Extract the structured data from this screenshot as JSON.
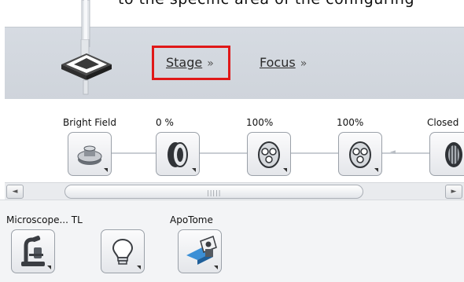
{
  "top": {
    "cropped_text": "to the specific area of the configuring"
  },
  "nav": {
    "stage_label": "Stage",
    "focus_label": "Focus",
    "chevron": "»"
  },
  "light_path": {
    "labels": [
      "Bright Field",
      "0 %",
      "100%",
      "100%",
      "Closed"
    ],
    "icons": [
      "reflector-icon",
      "ring-filter-icon",
      "filter-wheel-icon",
      "filter-wheel-icon",
      "grid-filter-icon"
    ]
  },
  "scrollbar": {
    "left_arrow": "◄",
    "right_arrow": "►",
    "grip": "|||||"
  },
  "tools": {
    "labels": [
      "Microscope... TL",
      "ApoTome"
    ],
    "icons": [
      "microscope-icon",
      "lightbulb-icon",
      "apotome-icon"
    ]
  },
  "colors": {
    "highlight": "#e01818",
    "nav_bg": "#d3d8de",
    "tile_border": "#9aa0a8"
  }
}
